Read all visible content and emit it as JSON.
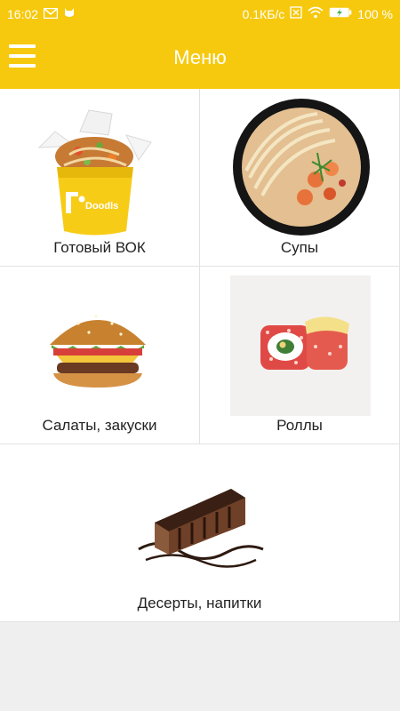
{
  "status": {
    "time": "16:02",
    "net_speed": "0.1КБ/с",
    "battery": "100 %"
  },
  "appbar": {
    "title": "Меню",
    "menu_icon": "hamburger-icon"
  },
  "categories": [
    {
      "label": "Готовый ВОК",
      "image": "wok-box-image"
    },
    {
      "label": "Супы",
      "image": "soup-bowl-image"
    },
    {
      "label": "Салаты, закуски",
      "image": "burger-image"
    },
    {
      "label": "Роллы",
      "image": "sushi-rolls-image"
    },
    {
      "label": "Десерты, напитки",
      "image": "cake-slice-image"
    }
  ],
  "wok_box_text": "Doodls",
  "colors": {
    "accent": "#f6c90e",
    "background": "#efefef",
    "tile": "#ffffff"
  }
}
